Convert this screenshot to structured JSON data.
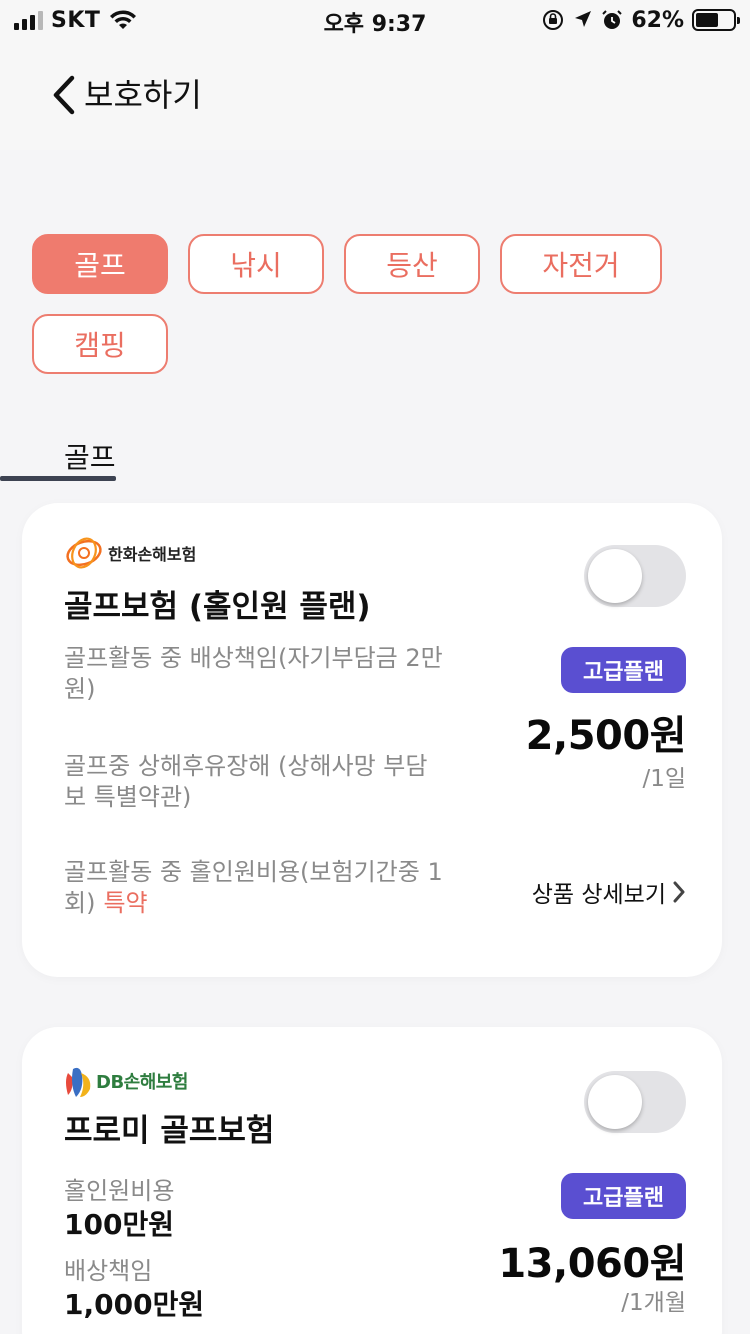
{
  "status_bar": {
    "carrier": "SKT",
    "time": "오후 9:37",
    "battery": "62%",
    "battery_level": 0.62
  },
  "nav": {
    "title": "보호하기"
  },
  "categories": [
    {
      "label": "골프",
      "active": true
    },
    {
      "label": "낚시",
      "active": false
    },
    {
      "label": "등산",
      "active": false
    },
    {
      "label": "자전거",
      "active": false
    },
    {
      "label": "캠핑",
      "active": false
    }
  ],
  "section_tab": "골프",
  "products": [
    {
      "insurer": "한화손해보험",
      "name": "골프보험 (홀인원 플랜)",
      "enabled": false,
      "features": [
        "골프활동 중 배상책임(자기부담금 2만원)",
        "골프중 상해후유장해 (상해사망 부담보 특별약관)",
        "골프활동 중 홀인원비용(보험기간중 1회)"
      ],
      "special_tag": "특약",
      "badge": "고급플랜",
      "price": "2,500원",
      "period": "/1일",
      "detail_link": "상품 상세보기"
    },
    {
      "insurer": "DB손해보험",
      "name": "프로미 골프보험",
      "enabled": false,
      "coverages": [
        {
          "label": "홀인원비용",
          "value": "100만원"
        },
        {
          "label": "배상책임",
          "value": "1,000만원"
        }
      ],
      "badge": "고급플랜",
      "price": "13,060원",
      "period": "/1개월"
    }
  ],
  "colors": {
    "accent": "#ef7b6e",
    "badge": "#5a4fd1",
    "background": "#f5f5f7"
  }
}
